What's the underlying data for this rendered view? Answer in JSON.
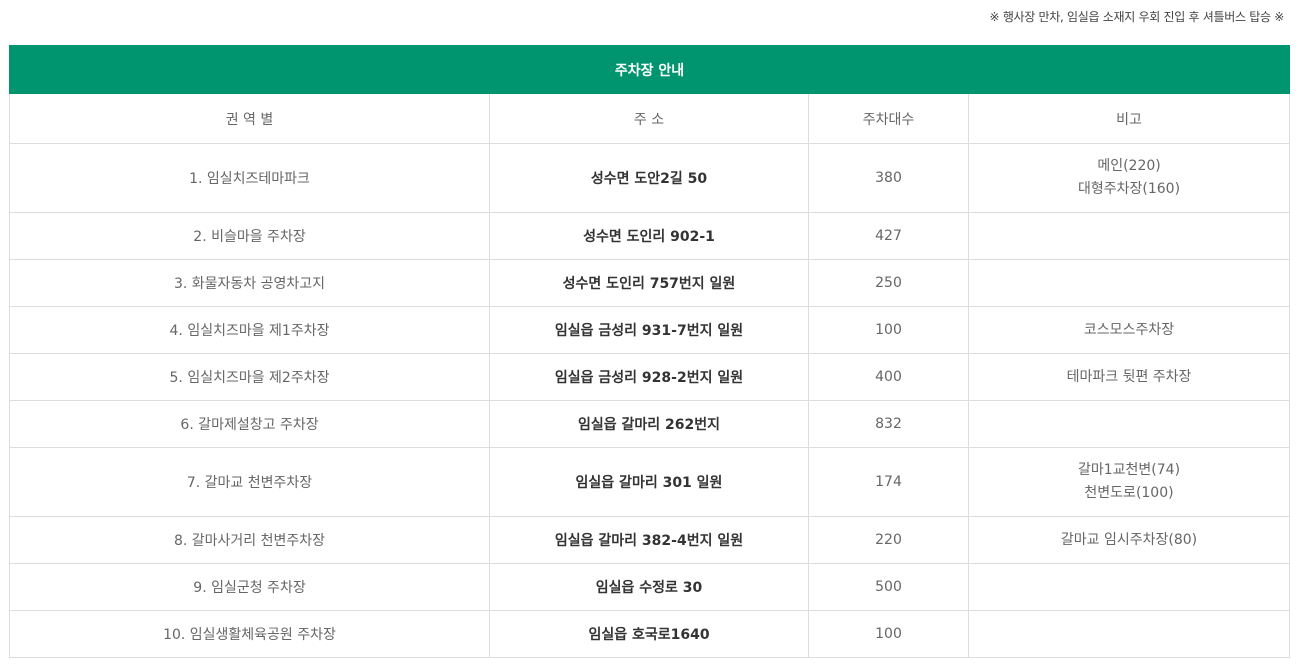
{
  "note": "※ 행사장 만차, 임실읍 소재지 우회 진입 후 셔틀버스 탑승 ※",
  "table": {
    "title": "주차장 안내",
    "headers": [
      "권 역 별",
      "주 소",
      "주차대수",
      "비고"
    ],
    "rows": [
      {
        "name": "1. 임실치즈테마파크",
        "address": "성수면 도안2길 50",
        "count": "380",
        "notes": [
          "메인(220)",
          "대형주차장(160)"
        ]
      },
      {
        "name": "2. 비슬마을 주차장",
        "address": "성수면 도인리 902-1",
        "count": "427",
        "notes": []
      },
      {
        "name": "3. 화물자동차 공영차고지",
        "address": "성수면 도인리 757번지 일원",
        "count": "250",
        "notes": []
      },
      {
        "name": "4. 임실치즈마을 제1주차장",
        "address": "임실읍 금성리 931-7번지 일원",
        "count": "100",
        "notes": [
          "코스모스주차장"
        ]
      },
      {
        "name": "5. 임실치즈마을 제2주차장",
        "address": "임실읍 금성리 928-2번지 일원",
        "count": "400",
        "notes": [
          "테마파크 뒷편 주차장"
        ]
      },
      {
        "name": "6. 갈마제설창고 주차장",
        "address": "임실읍 갈마리 262번지",
        "count": "832",
        "notes": []
      },
      {
        "name": "7. 갈마교 천변주차장",
        "address": "임실읍 갈마리 301 일원",
        "count": "174",
        "notes": [
          "갈마1교천변(74)",
          "천변도로(100)"
        ]
      },
      {
        "name": "8. 갈마사거리 천변주차장",
        "address": "임실읍 갈마리 382-4번지 일원",
        "count": "220",
        "notes": [
          "갈마교 임시주차장(80)"
        ]
      },
      {
        "name": "9. 임실군청 주차장",
        "address": "임실읍 수정로 30",
        "count": "500",
        "notes": []
      },
      {
        "name": "10. 임실생활체육공원 주차장",
        "address": "임실읍 호국로1640",
        "count": "100",
        "notes": []
      }
    ]
  }
}
